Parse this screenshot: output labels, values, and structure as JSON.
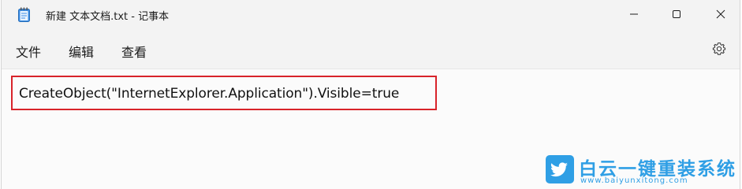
{
  "window": {
    "title": "新建 文本文档.txt - 记事本"
  },
  "menu": {
    "file": "文件",
    "edit": "编辑",
    "view": "查看"
  },
  "icons": {
    "app": "notepad-icon",
    "minimize": "minimize-icon",
    "maximize": "maximize-icon",
    "close": "close-icon",
    "settings": "gear-icon"
  },
  "editor": {
    "content": "CreateObject(\"InternetExplorer.Application\").Visible=true"
  },
  "watermark": {
    "title": "白云一键重装系统",
    "url": "www.baiyunxitong.com"
  },
  "colors": {
    "highlight_border": "#d8232a",
    "watermark_blue": "#2f9fe5"
  }
}
